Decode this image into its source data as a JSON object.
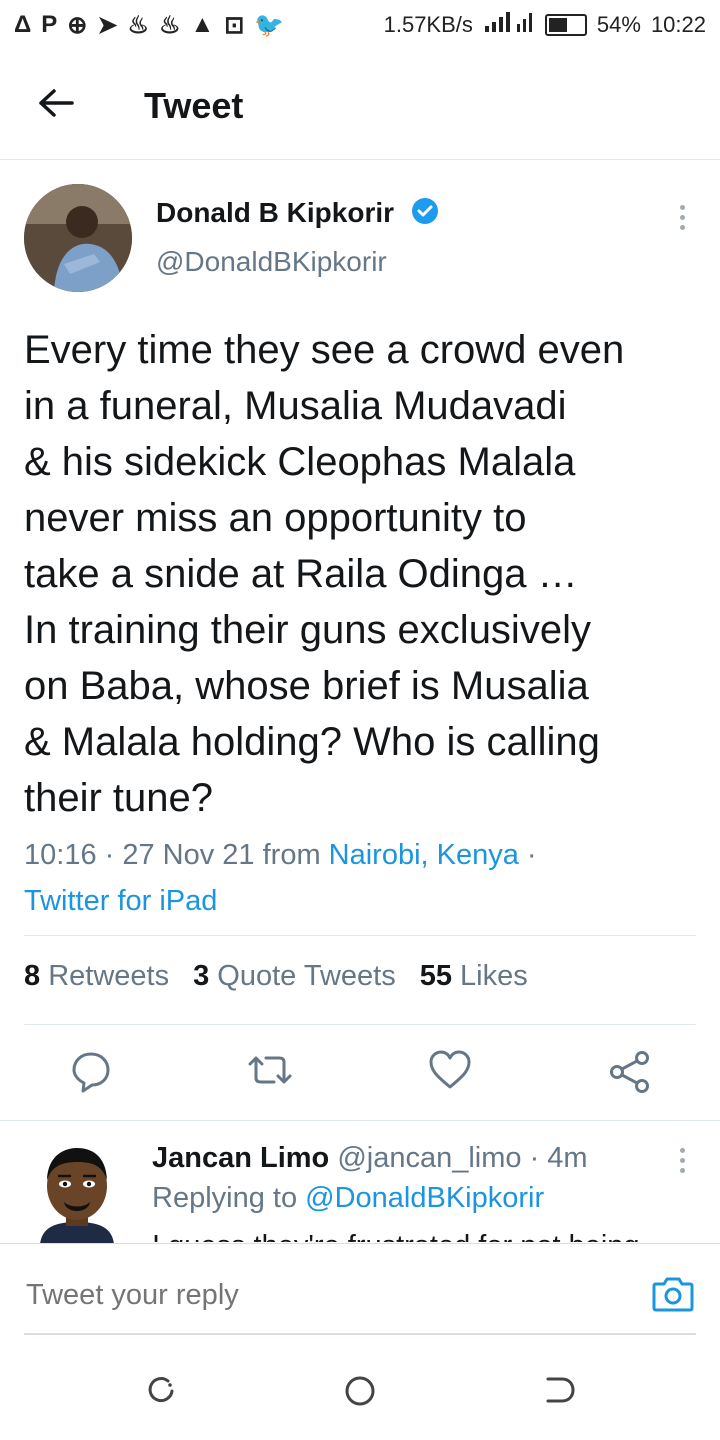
{
  "status_bar": {
    "left_icons": [
      "Δ",
      "P",
      "⊕",
      "➤",
      "♨",
      "♨",
      "▲",
      "⊡",
      "🐦"
    ],
    "network_speed": "1.57KB/s",
    "battery_percent": "54%",
    "battery_level": 0.54,
    "time": "10:22"
  },
  "header": {
    "title": "Tweet"
  },
  "tweet": {
    "author_name": "Donald B Kipkorir",
    "handle": "@DonaldBKipkorir",
    "text": "Every time they see a crowd even\nin a funeral, Musalia Mudavadi\n& his sidekick Cleophas Malala\nnever miss an opportunity to\ntake a snide at Raila Odinga …\nIn training their guns exclusively\non Baba, whose brief is Musalia\n& Malala holding? Who is calling\ntheir tune?",
    "time_date": "10:16 · 27 Nov 21 from ",
    "location": "Nairobi, Kenya",
    "sep": " ·",
    "source": "Twitter for iPad",
    "retweets_count": "8",
    "retweets_label": "Retweets",
    "quotes_count": "3",
    "quotes_label": "Quote Tweets",
    "likes_count": "55",
    "likes_label": "Likes"
  },
  "reply": {
    "name": "Jancan Limo",
    "handle_time": " @jancan_limo · 4m",
    "replying_prefix": "Replying to ",
    "replying_to": "@DonaldBKipkorir",
    "text_partial": "I guess they're frustrated for not being"
  },
  "compose": {
    "placeholder": "Tweet your reply"
  },
  "colors": {
    "accent": "#1b95e0",
    "secondary_text": "#657786",
    "divider": "#e1e8ed"
  },
  "icons": [
    "back-arrow-icon",
    "verified-badge-icon",
    "more-vert-icon",
    "reply-icon",
    "retweet-icon",
    "like-icon",
    "share-icon",
    "camera-icon",
    "nav-recent-icon",
    "nav-home-icon",
    "nav-back-icon"
  ]
}
